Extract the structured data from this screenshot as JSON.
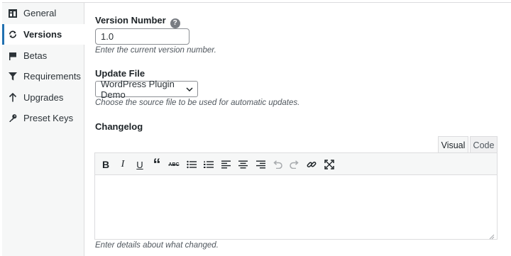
{
  "sidebar": {
    "items": [
      {
        "label": "General",
        "icon": "general-icon"
      },
      {
        "label": "Versions",
        "icon": "sync-icon",
        "active": true
      },
      {
        "label": "Betas",
        "icon": "flag-icon"
      },
      {
        "label": "Requirements",
        "icon": "filter-icon"
      },
      {
        "label": "Upgrades",
        "icon": "arrow-up-icon"
      },
      {
        "label": "Preset Keys",
        "icon": "key-icon"
      }
    ]
  },
  "version": {
    "label": "Version Number",
    "help": "?",
    "value": "1.0",
    "description": "Enter the current version number."
  },
  "update_file": {
    "label": "Update File",
    "selected": "WordPress Plugin Demo",
    "description": "Choose the source file to be used for automatic updates."
  },
  "changelog": {
    "label": "Changelog",
    "tabs": {
      "visual": "Visual",
      "code": "Code"
    },
    "active_tab": "Visual",
    "toolbar": [
      "bold",
      "italic",
      "underline",
      "blockquote",
      "strikethrough",
      "bulleted-list",
      "numbered-list",
      "align-left",
      "align-center",
      "align-right",
      "undo",
      "redo",
      "link",
      "fullscreen"
    ],
    "bold_glyph": "B",
    "italic_glyph": "I",
    "underline_glyph": "U",
    "quote_glyph": "“",
    "strike_glyph": "ABC",
    "content": "",
    "description": "Enter details about what changed."
  },
  "colors": {
    "accent": "#2271b1",
    "border": "#dcdcde",
    "muted": "#50575e"
  }
}
